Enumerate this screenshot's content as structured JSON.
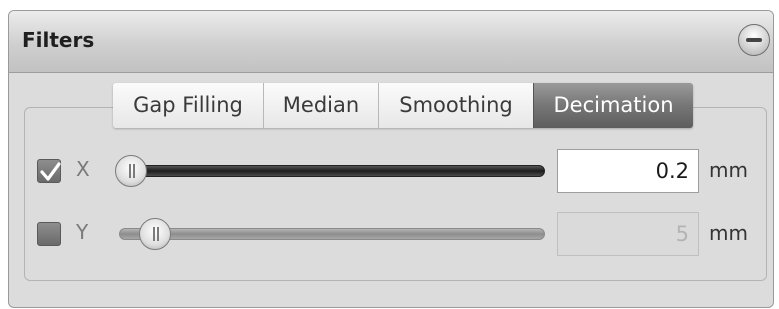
{
  "panel": {
    "title": "Filters",
    "collapse_icon": "minus-circle-icon"
  },
  "tabs": [
    {
      "label": "Gap Filling",
      "active": false
    },
    {
      "label": "Median",
      "active": false
    },
    {
      "label": "Smoothing",
      "active": false
    },
    {
      "label": "Decimation",
      "active": true
    }
  ],
  "rows": [
    {
      "axis": "X",
      "enabled": true,
      "value": "0.2",
      "unit": "mm",
      "slider_fraction": 0.0
    },
    {
      "axis": "Y",
      "enabled": false,
      "value": "5",
      "unit": "mm",
      "slider_fraction": 0.06
    }
  ],
  "colors": {
    "active_tab": "#767676",
    "slider_active": "#1d1d1d",
    "slider_inactive": "#8d8d8d"
  }
}
